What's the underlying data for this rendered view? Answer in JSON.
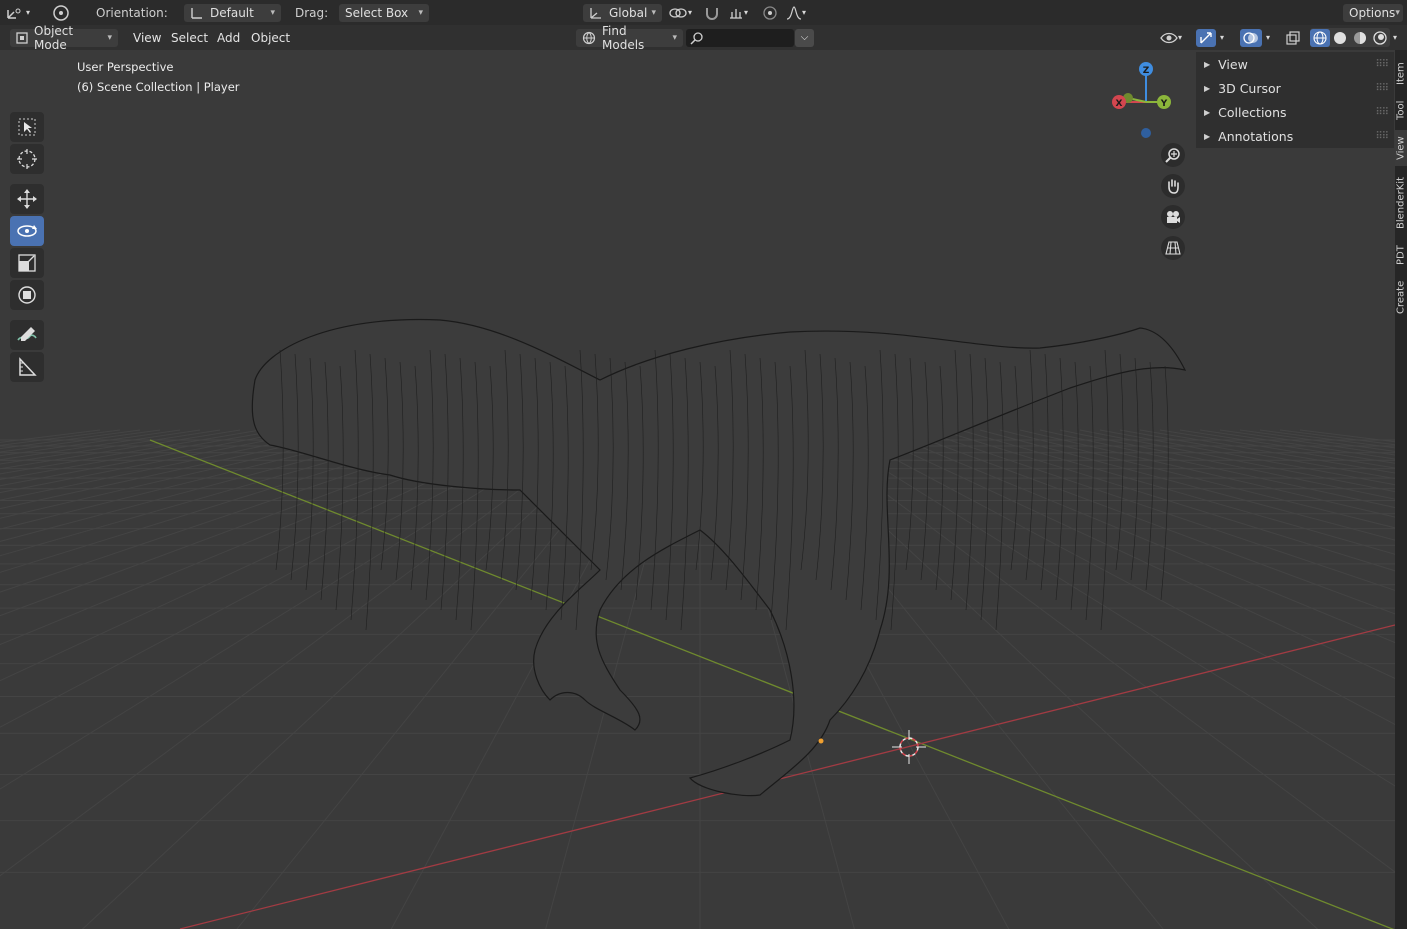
{
  "topbar": {
    "orientation_label": "Orientation:",
    "orientation_value": "Default",
    "drag_label": "Drag:",
    "drag_value": "Select Box",
    "transform_orientation": "Global",
    "options_label": "Options"
  },
  "header": {
    "mode": "Object Mode",
    "menus": [
      "View",
      "Select",
      "Add",
      "Object"
    ],
    "find_models": "Find Models",
    "search_value": ""
  },
  "viewport": {
    "perspective": "User Perspective",
    "collection": "(6) Scene Collection | Player",
    "gizmo": {
      "x": "X",
      "y": "Y",
      "z": "Z"
    }
  },
  "npanel": {
    "items": [
      "View",
      "3D Cursor",
      "Collections",
      "Annotations"
    ]
  },
  "sidetabs": [
    "Item",
    "Tool",
    "View",
    "BlenderKit",
    "PDT",
    "Create"
  ],
  "colors": {
    "accent": "#4a72b2",
    "x_axis": "#d3464f",
    "y_axis": "#8cb63b",
    "z_axis": "#3f8de0",
    "grid": "#454545",
    "background": "#3a3a3a"
  },
  "icons": {
    "editor_type": "3d-viewport-icon",
    "tools": [
      "select-box-icon",
      "cursor-icon",
      "move-icon",
      "rotate-icon",
      "scale-icon",
      "transform-icon",
      "annotate-icon",
      "measure-icon"
    ],
    "nav": [
      "zoom-icon",
      "pan-hand-icon",
      "camera-icon",
      "grid-ortho-icon"
    ]
  }
}
